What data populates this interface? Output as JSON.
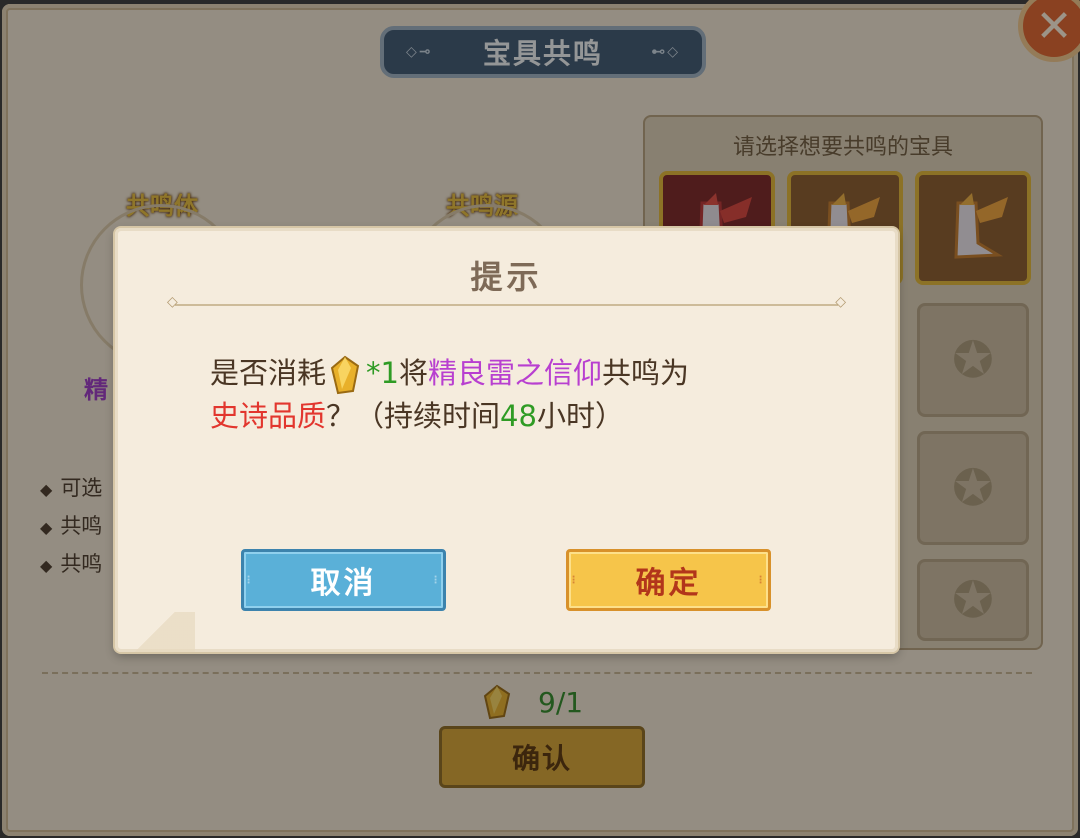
{
  "panel": {
    "title": "宝具共鸣",
    "close_icon": "close-x-icon",
    "left_slot_label": "共鸣体",
    "right_slot_label": "共鸣源",
    "left_quality_partial": "精",
    "rules_partial": [
      "可选",
      "共鸣",
      "共鸣"
    ],
    "select_title": "请选择想要共鸣的宝具",
    "cost_value": "9/1",
    "confirm_label": "确认"
  },
  "dialog": {
    "title": "提示",
    "msg_prefix": "是否消耗",
    "msg_count": "*1",
    "msg_mid": "将",
    "msg_item": "精良雷之信仰",
    "msg_mid2": "共鸣为",
    "msg_quality": "史诗品质",
    "msg_q": "？（持续时间",
    "msg_hours": "48",
    "msg_suffix": "小时）",
    "cancel_label": "取消",
    "ok_label": "确定",
    "gem_icon": "gold-crystal-icon"
  },
  "colors": {
    "green": "#2f9b24",
    "purple": "#b83fd0",
    "red": "#e2362e",
    "title_plate": "#3d5670"
  }
}
